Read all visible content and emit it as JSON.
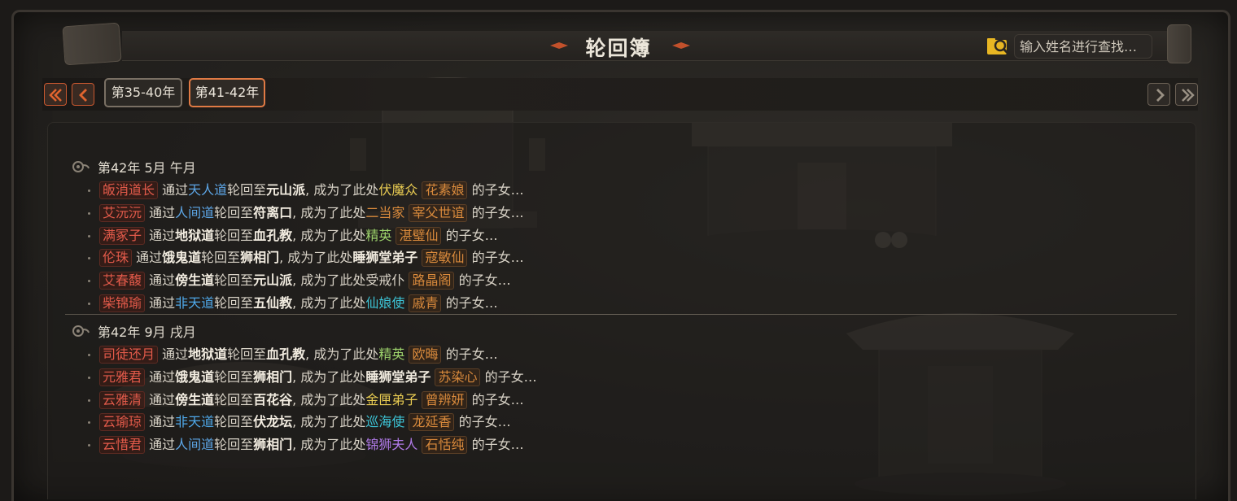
{
  "header": {
    "title": "轮回簿",
    "search_placeholder": "输入姓名进行查找…"
  },
  "tabs": [
    {
      "label": "第35-40年",
      "active": false
    },
    {
      "label": "第41-42年",
      "active": true
    }
  ],
  "colors": {
    "accent": "#e07a44",
    "name_red": "#e25a4a",
    "parent_orange": "#d98a3c",
    "path_blue": "#5da7e8"
  },
  "sections": [
    {
      "date": "第42年 5月  午月",
      "entries": [
        {
          "name": "皈消道长",
          "via": "通过",
          "path": "天人道",
          "mid": "轮回至",
          "sect": "元山派",
          "became": ", 成为了此处",
          "role": "伏魔众",
          "parent": "花素娘",
          "tail": "的子女…"
        },
        {
          "name": "艾沅沅",
          "via": "通过",
          "path": "人间道",
          "mid": "轮回至",
          "sect": "符离口",
          "became": ", 成为了此处",
          "role": "二当家",
          "parent": "宰父世谊",
          "tail": "的子女…"
        },
        {
          "name": "满冢子",
          "via": "通过",
          "path": "地狱道",
          "mid": "轮回至",
          "sect": "血孔教",
          "became": ", 成为了此处",
          "role": "精英",
          "parent": "湛璧仙",
          "tail": "的子女…"
        },
        {
          "name": "伦珠",
          "via": "通过",
          "path": "饿鬼道",
          "mid": "轮回至",
          "sect": "狮相门",
          "became": ", 成为了此处",
          "role": "睡狮堂弟子",
          "parent": "寇敏仙",
          "tail": "的子女…"
        },
        {
          "name": "艾春馥",
          "via": "通过",
          "path": "傍生道",
          "mid": "轮回至",
          "sect": "元山派",
          "became": ", 成为了此处",
          "role": "受戒仆",
          "parent": "路晶阁",
          "tail": "的子女…"
        },
        {
          "name": "柴锦瑜",
          "via": "通过",
          "path": "非天道",
          "mid": "轮回至",
          "sect": "五仙教",
          "became": ", 成为了此处",
          "role": "仙娘使",
          "parent": "戚青",
          "tail": "的子女…"
        }
      ]
    },
    {
      "date": "第42年 9月  戌月",
      "entries": [
        {
          "name": "司徒还月",
          "via": "通过",
          "path": "地狱道",
          "mid": "轮回至",
          "sect": "血孔教",
          "became": ", 成为了此处",
          "role": "精英",
          "parent": "欧晦",
          "tail": "的子女…"
        },
        {
          "name": "元雅君",
          "via": "通过",
          "path": "饿鬼道",
          "mid": "轮回至",
          "sect": "狮相门",
          "became": ", 成为了此处",
          "role": "睡狮堂弟子",
          "parent": "苏染心",
          "tail": "的子女…"
        },
        {
          "name": "云雅清",
          "via": "通过",
          "path": "傍生道",
          "mid": "轮回至",
          "sect": "百花谷",
          "became": ", 成为了此处",
          "role": "金匣弟子",
          "parent": "曾辨妍",
          "tail": "的子女…"
        },
        {
          "name": "云瑜琼",
          "via": "通过",
          "path": "非天道",
          "mid": "轮回至",
          "sect": "伏龙坛",
          "became": ", 成为了此处",
          "role": "巡海使",
          "parent": "龙延香",
          "tail": "的子女…"
        },
        {
          "name": "云惜君",
          "via": "通过",
          "path": "人间道",
          "mid": "轮回至",
          "sect": "狮相门",
          "became": ", 成为了此处",
          "role": "锦狮夫人",
          "parent": "石恬纯",
          "tail": "的子女…"
        }
      ]
    }
  ]
}
